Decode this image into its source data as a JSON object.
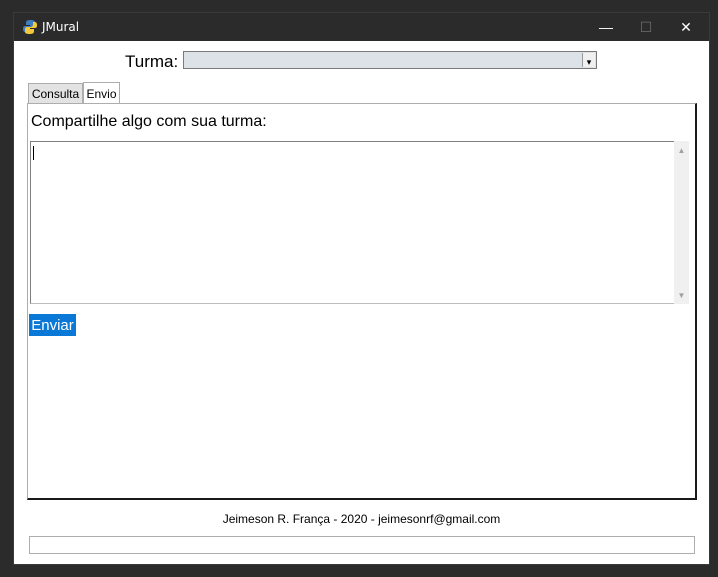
{
  "window": {
    "title": "JMural",
    "icon": "python-icon",
    "controls": {
      "minimize": "—",
      "maximize": "☐",
      "close": "✕"
    }
  },
  "turma": {
    "label": "Turma:",
    "selected": "",
    "arrow": "▾"
  },
  "tabs": [
    {
      "label": "Consulta",
      "active": false
    },
    {
      "label": "Envio",
      "active": true
    }
  ],
  "envio": {
    "prompt": "Compartilhe algo com sua turma:",
    "message": "",
    "send_label": "Enviar"
  },
  "footer": {
    "credit": "Jeimeson R. França - 2020 - jeimesonrf@gmail.com"
  },
  "status": {
    "text": ""
  },
  "colors": {
    "titlebar": "#2b2b2b",
    "accent": "#0a78d7",
    "select_bg": "#dde1e8"
  }
}
